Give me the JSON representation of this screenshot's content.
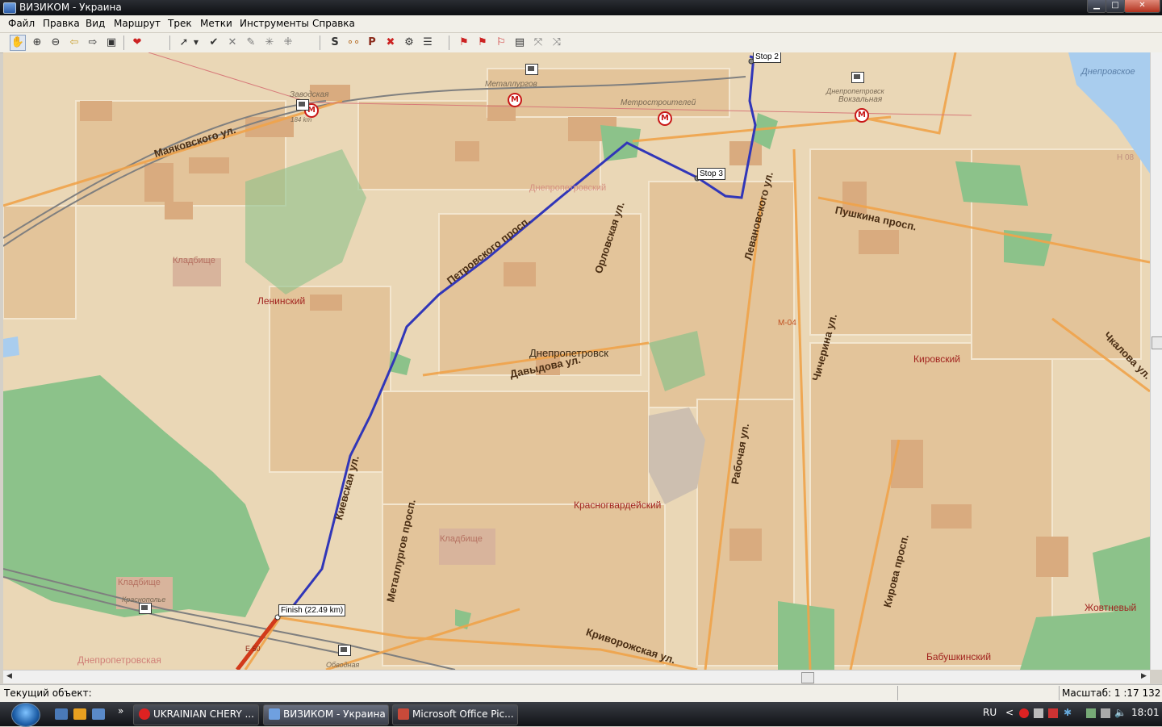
{
  "window": {
    "title": "ВИЗИКОМ - Украина",
    "controls": {
      "minimize": "▁",
      "maximize": "□",
      "close": "✕"
    }
  },
  "menu": [
    "Файл",
    "Правка",
    "Вид",
    "Маршрут",
    "Трек",
    "Метки",
    "Инструменты",
    "Справка"
  ],
  "toolbar": {
    "icons": [
      "hand-tool-icon",
      "zoom-in-icon",
      "zoom-out-icon",
      "back-arrow-icon",
      "forward-arrow-icon",
      "fit-map-icon",
      "route-heart-icon",
      "select-arrow-icon",
      "dropdown-icon",
      "check-route-icon",
      "cross-route-icon",
      "edit-route-icon",
      "star-icon",
      "grid-icon",
      "gps-s-icon",
      "dots-icon",
      "parking-p-icon",
      "delete-points-icon",
      "route-settings-icon",
      "route-list-icon",
      "flag-start-icon",
      "flag-add-icon",
      "flag-move-icon",
      "flag-list-icon",
      "waypoints-cross-icon",
      "waypoints-connect-icon"
    ]
  },
  "map": {
    "colors": {
      "background": "#ead7b6",
      "block": "#e3c49a",
      "building": "#d9ab7f",
      "park": "#8cc28a",
      "water": "#a9cdee",
      "road": "#f0a34a",
      "route": "#3136b8",
      "rail": "#7f7f7f"
    },
    "districts": [
      "Ленинский",
      "Днепропетровск",
      "Днепропетровский",
      "Красногвардейский",
      "Кировский",
      "Жовтневый",
      "Бабушкинский",
      "Днепропетровская"
    ],
    "streets": [
      "Маяковского ул.",
      "Петровского просп.",
      "Орловская ул.",
      "Левановского ул.",
      "Пушкина просп.",
      "Давыдова ул.",
      "Киевская ул.",
      "Металлургов просп.",
      "Рабочая ул.",
      "Чичерина ул.",
      "Кирова просп.",
      "Криворожская ул.",
      "Чкалова ул."
    ],
    "stations": [
      "Заводская",
      "Металлургов",
      "Метростроителей",
      "Днепропетровск",
      "Вокзальная",
      "Краснополье",
      "Обводная"
    ],
    "cemeteries": [
      "Кладбище",
      "Кладбище",
      "Кладбище"
    ],
    "water": "Днепровское",
    "small_labels": {
      "km": "184 km",
      "e50": "E 50",
      "m04": "М-04",
      "h08": "Н 08"
    },
    "waypoints": {
      "stop2": "Stop 2",
      "stop3": "Stop 3",
      "finish": "Finish (22.49 km)"
    }
  },
  "status": {
    "current_object_label": "Текущий объект:",
    "scale": "Масштаб: 1 :17 132"
  },
  "taskbar": {
    "tasks": [
      "UKRAINIAN CHERY ...",
      "ВИЗИКОМ - Украина",
      "Microsoft Office Pic..."
    ],
    "quicklaunch_more": "»",
    "lang": "RU",
    "tray_arrow": "<",
    "clock": "18:01"
  }
}
